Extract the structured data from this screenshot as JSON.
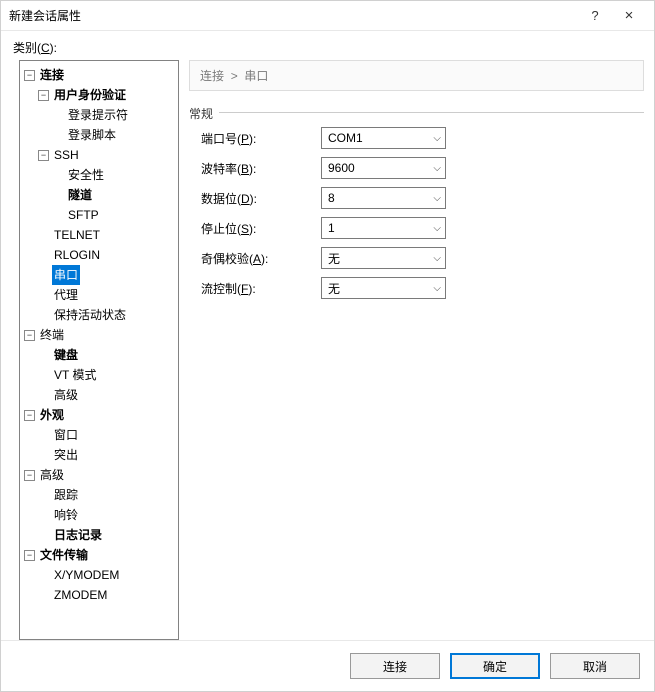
{
  "window": {
    "title": "新建会话属性",
    "help": "?",
    "close": "×"
  },
  "category_label_prefix": "类别(",
  "category_label_key": "C",
  "category_label_suffix": "):",
  "tree": {
    "connection": {
      "label": "连接",
      "bold": true,
      "expanded": true,
      "children": {
        "auth": {
          "label": "用户身份验证",
          "bold": true,
          "expanded": true,
          "children": {
            "prompt": {
              "label": "登录提示符"
            },
            "script": {
              "label": "登录脚本"
            }
          }
        },
        "ssh": {
          "label": "SSH",
          "bold": false,
          "expanded": true,
          "children": {
            "sec": {
              "label": "安全性"
            },
            "tunnel": {
              "label": "隧道",
              "bold": true
            },
            "sftp": {
              "label": "SFTP"
            }
          }
        },
        "telnet": {
          "label": "TELNET"
        },
        "rlogin": {
          "label": "RLOGIN"
        },
        "serial": {
          "label": "串口",
          "selected": true
        },
        "proxy": {
          "label": "代理"
        },
        "keepalive": {
          "label": "保持活动状态"
        }
      }
    },
    "terminal": {
      "label": "终端",
      "bold": false,
      "expanded": true,
      "children": {
        "keyboard": {
          "label": "键盘",
          "bold": true
        },
        "vt": {
          "label": "VT 模式"
        },
        "advanced": {
          "label": "高级"
        }
      }
    },
    "appearance": {
      "label": "外观",
      "bold": true,
      "expanded": true,
      "children": {
        "window": {
          "label": "窗口"
        },
        "highlight": {
          "label": "突出"
        }
      }
    },
    "advanced": {
      "label": "高级",
      "bold": false,
      "expanded": true,
      "children": {
        "trace": {
          "label": "跟踪"
        },
        "bell": {
          "label": "响铃"
        },
        "log": {
          "label": "日志记录",
          "bold": true
        }
      }
    },
    "filetransfer": {
      "label": "文件传输",
      "bold": true,
      "expanded": true,
      "children": {
        "xymodem": {
          "label": "X/YMODEM"
        },
        "zmodem": {
          "label": "ZMODEM"
        }
      }
    }
  },
  "breadcrumb": {
    "a": "连接",
    "sep": ">",
    "b": "串口"
  },
  "group_title": "常规",
  "fields": {
    "port": {
      "label_a": "端口号(",
      "key": "P",
      "label_b": "):",
      "value": "COM1"
    },
    "baud": {
      "label_a": "波特率(",
      "key": "B",
      "label_b": "):",
      "value": "9600"
    },
    "data": {
      "label_a": "数据位(",
      "key": "D",
      "label_b": "):",
      "value": "8"
    },
    "stop": {
      "label_a": "停止位(",
      "key": "S",
      "label_b": "):",
      "value": "1"
    },
    "parity": {
      "label_a": "奇偶校验(",
      "key": "A",
      "label_b": "):",
      "value": "无"
    },
    "flow": {
      "label_a": "流控制(",
      "key": "F",
      "label_b": "):",
      "value": "无"
    }
  },
  "buttons": {
    "connect": "连接",
    "ok": "确定",
    "cancel": "取消"
  },
  "glyph": {
    "minus": "−",
    "chev": "⌵"
  }
}
